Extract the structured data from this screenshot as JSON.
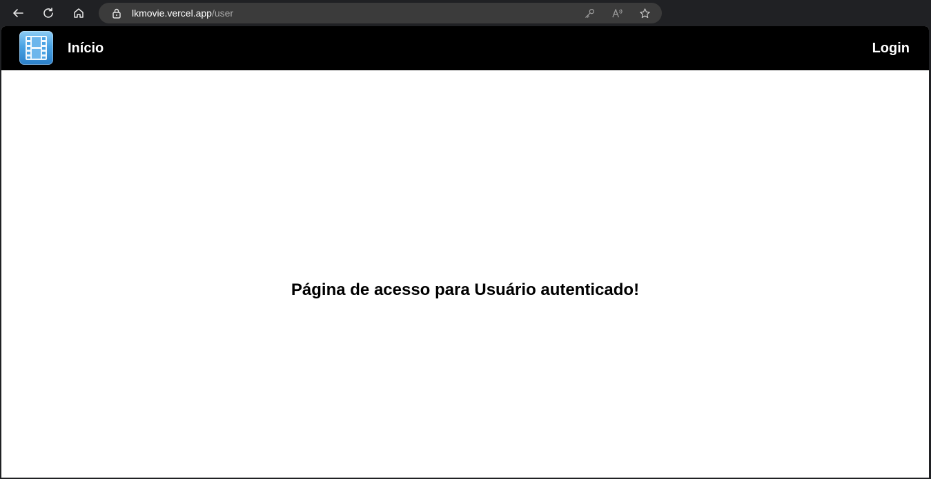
{
  "browser": {
    "url_host": "lkmovie.vercel.app",
    "url_path": "/user",
    "icons": [
      "back-icon",
      "refresh-icon",
      "home-icon",
      "lock-icon",
      "key-icon",
      "read-aloud-icon",
      "favorite-star-icon"
    ]
  },
  "navbar": {
    "logo_icon": "film-strip-icon",
    "home_label": "Início",
    "login_label": "Login"
  },
  "main": {
    "message": "Página de acesso para Usuário autenticado!"
  },
  "colors": {
    "navbar_bg": "#000000",
    "page_bg": "#ffffff",
    "browser_chrome": "#202124",
    "logo_blue": "#4aa3e4"
  }
}
